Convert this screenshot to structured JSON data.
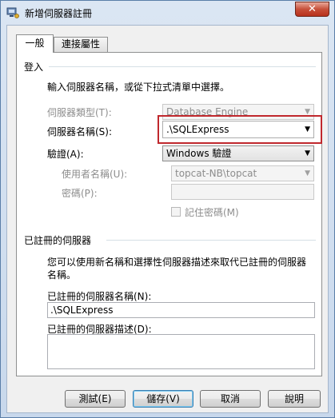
{
  "window": {
    "title": "新增伺服器註冊",
    "close_glyph": "✕"
  },
  "tabs": [
    {
      "label": "一般"
    },
    {
      "label": "連接屬性"
    }
  ],
  "login": {
    "group_label": "登入",
    "instruction": "輸入伺服器名稱，或從下拉式清單中選擇。",
    "server_type_label": "伺服器類型(T):",
    "server_type_value": "Database Engine",
    "server_name_label": "伺服器名稱(S):",
    "server_name_value": ".\\SQLExpress",
    "auth_label": "驗證(A):",
    "auth_value": "Windows 驗證",
    "username_label": "使用者名稱(U):",
    "username_value": "topcat-NB\\topcat",
    "password_label": "密碼(P):",
    "password_value": "",
    "remember_label": "記住密碼(M)"
  },
  "registered": {
    "group_label": "已註冊的伺服器",
    "instruction_line1": "您可以使用新名稱和選擇性伺服器描述來取代已註冊的伺服器",
    "instruction_line2": "名稱。",
    "name_label": "已註冊的伺服器名稱(N):",
    "name_value": ".\\SQLExpress",
    "desc_label": "已註冊的伺服器描述(D):",
    "desc_value": ""
  },
  "buttons": {
    "test": "測試(E)",
    "save": "儲存(V)",
    "cancel": "取消",
    "help": "說明"
  },
  "icons": {
    "dropdown": "▼"
  },
  "colors": {
    "highlight": "#c0282d",
    "close": "#c7503a"
  }
}
